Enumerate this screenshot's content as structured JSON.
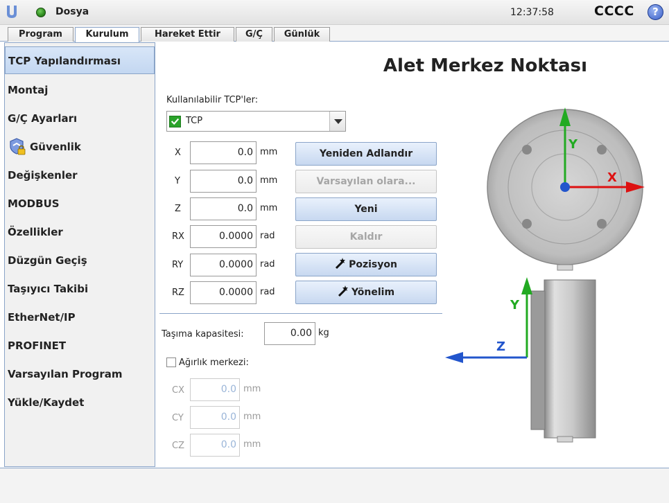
{
  "header": {
    "file_label": "Dosya",
    "clock": "12:37:58",
    "robot_name": "CCCC",
    "help_symbol": "?"
  },
  "tabs": [
    {
      "label": "Program",
      "active": false
    },
    {
      "label": "Kurulum",
      "active": true
    },
    {
      "label": "Hareket Ettir",
      "active": false
    },
    {
      "label": "G/Ç",
      "active": false
    },
    {
      "label": "Günlük",
      "active": false
    }
  ],
  "sidebar": {
    "items": [
      {
        "label": "TCP Yapılandırması",
        "active": true
      },
      {
        "label": "Montaj"
      },
      {
        "label": "G/Ç Ayarları"
      },
      {
        "label": "Güvenlik",
        "icon": "shield-lock-icon"
      },
      {
        "label": "Değişkenler"
      },
      {
        "label": "MODBUS"
      },
      {
        "label": "Özellikler"
      },
      {
        "label": "Düzgün Geçiş"
      },
      {
        "label": "Taşıyıcı Takibi"
      },
      {
        "label": "EtherNet/IP"
      },
      {
        "label": "PROFINET"
      },
      {
        "label": "Varsayılan Program"
      },
      {
        "label": "Yükle/Kaydet"
      }
    ]
  },
  "main": {
    "title": "Alet Merkez Noktası",
    "available_label": "Kullanılabilir TCP'ler:",
    "selected_tcp": "TCP",
    "coords": [
      {
        "axis": "X",
        "value": "0.0",
        "unit": "mm"
      },
      {
        "axis": "Y",
        "value": "0.0",
        "unit": "mm"
      },
      {
        "axis": "Z",
        "value": "0.0",
        "unit": "mm"
      },
      {
        "axis": "RX",
        "value": "0.0000",
        "unit": "rad"
      },
      {
        "axis": "RY",
        "value": "0.0000",
        "unit": "rad"
      },
      {
        "axis": "RZ",
        "value": "0.0000",
        "unit": "rad"
      }
    ],
    "buttons": {
      "rename": "Yeniden Adlandır",
      "set_default": "Varsayılan olara...",
      "new": "Yeni",
      "remove": "Kaldır",
      "position": "Pozisyon",
      "orientation": "Yönelim"
    },
    "payload_label": "Taşıma kapasitesi:",
    "payload_value": "0.00",
    "payload_unit": "kg",
    "cog_label": "Ağırlık merkezi:",
    "cog_checked": false,
    "cog": [
      {
        "axis": "CX",
        "value": "0.0",
        "unit": "mm"
      },
      {
        "axis": "CY",
        "value": "0.0",
        "unit": "mm"
      },
      {
        "axis": "CZ",
        "value": "0.0",
        "unit": "mm"
      }
    ]
  },
  "figure": {
    "top_view_axes": {
      "y": "Y",
      "x": "X"
    },
    "side_view_axes": {
      "y": "Y",
      "z": "Z"
    },
    "colors": {
      "y_axis": "#22aa22",
      "x_axis": "#dd1111",
      "z_axis": "#2255cc"
    }
  }
}
